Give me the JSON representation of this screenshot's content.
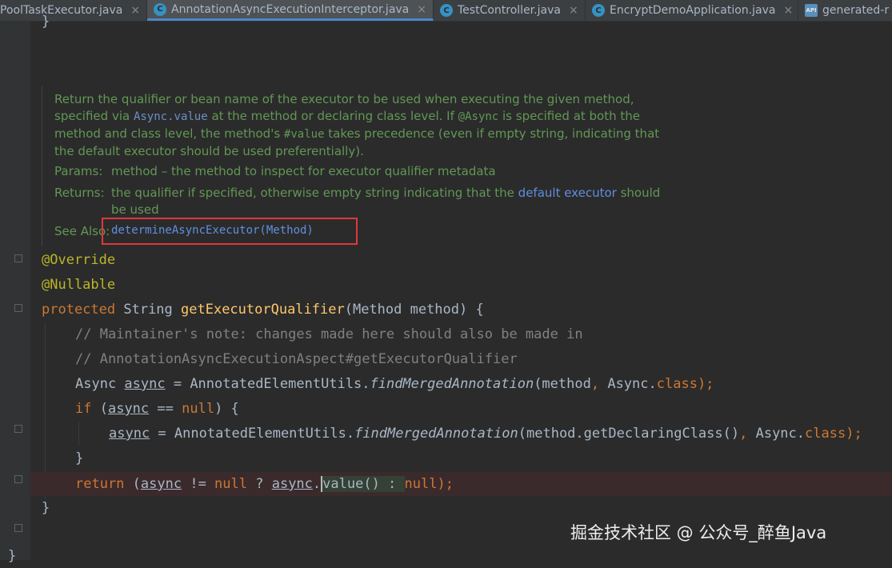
{
  "tabs": [
    {
      "label": "PoolTaskExecutor.java",
      "icon": "java-class-icon",
      "active": false
    },
    {
      "label": "AnnotationAsyncExecutionInterceptor.java",
      "icon": "java-class-icon",
      "active": true
    },
    {
      "label": "TestController.java",
      "icon": "java-class-icon",
      "active": false
    },
    {
      "label": "EncryptDemoApplication.java",
      "icon": "java-class-icon",
      "active": false
    },
    {
      "label": "generated-r",
      "icon": "api-icon",
      "active": false
    }
  ],
  "tab_close_glyph": "×",
  "doc": {
    "line1": "Return the qualifier or bean name of the executor to be used when executing the given method,",
    "line2_a": "specified via ",
    "line2_code": "Async.value",
    "line2_b": " at the method or declaring class level. If ",
    "line2_code2": "@Async",
    "line2_c": " is specified at both the",
    "line3_a": "method and class level, the method's ",
    "line3_code": "#value",
    "line3_b": " takes precedence (even if empty string, indicating that",
    "line4": "the default executor should be used preferentially).",
    "params_label": "Params:",
    "params_text": "method – the method to inspect for executor qualifier metadata",
    "returns_label": "Returns:",
    "returns_text_a": "the qualifier if specified, otherwise empty string indicating that the ",
    "returns_link": "default executor",
    "returns_text_b": " should",
    "returns_line2": "be used",
    "seealso_label": "See Also:",
    "seealso_link": "determineAsyncExecutor(Method)"
  },
  "code": {
    "top_brace": "}",
    "ann_override": "@Override",
    "ann_nullable": "@Nullable",
    "sig_kw": "protected",
    "sig_type": " String ",
    "sig_name": "getExecutorQualifier",
    "sig_rest": "(Method method) {",
    "comment1": "// Maintainer's note: changes made here should also be made in",
    "comment2": "// AnnotationAsyncExecutionAspect#getExecutorQualifier",
    "l6_a": "Async ",
    "l6_var": "async",
    "l6_b": " = AnnotatedElementUtils.",
    "l6_fn": "findMergedAnnotation",
    "l6_c": "(method",
    "l6_comma": ",",
    "l6_d": " Async.",
    "l6_cls": "class",
    "l6_e": ");",
    "l7_kw": "if",
    "l7_a": " (",
    "l7_var": "async",
    "l7_b": " == ",
    "l7_null": "null",
    "l7_c": ") {",
    "l8_var": "async",
    "l8_a": " = AnnotatedElementUtils.",
    "l8_fn": "findMergedAnnotation",
    "l8_b": "(method.getDeclaringClass()",
    "l8_comma": ",",
    "l8_c": " Async.",
    "l8_cls": "class",
    "l8_d": ");",
    "l9": "}",
    "l10_kw": "return",
    "l10_a": " (",
    "l10_var": "async",
    "l10_b": " != ",
    "l10_null": "null",
    "l10_c": " ? ",
    "l10_var2": "async",
    "l10_d": ".",
    "l10_caret": "v",
    "l10_e": "alue() : ",
    "l10_null2": "null",
    "l10_f": ");",
    "l11": "}",
    "l12": "}"
  },
  "watermark": "掘金技术社区 @ 公众号_醉鱼Java",
  "colors": {
    "background": "#2b2b2b",
    "keyword": "#cc7832",
    "annotation": "#bbb529",
    "method": "#ffc66d",
    "comment": "#808080",
    "doc_text": "#629755",
    "link": "#5f8fe0",
    "highlight_box": "#e0383b"
  }
}
